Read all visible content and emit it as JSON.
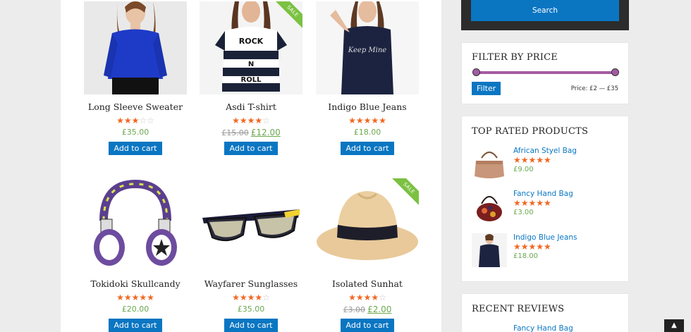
{
  "products": [
    {
      "name": "Long Sleeve Sweater",
      "rating": 3,
      "old_price": "",
      "price": "£35.00",
      "button": "Add to cart",
      "sale": false,
      "image": "blue-blouse-model"
    },
    {
      "name": "Asdi T-shirt",
      "rating": 4,
      "old_price": "£15.00",
      "price": "£12.00",
      "button": "Add to cart",
      "sale": true,
      "sale_label": "SALE",
      "image": "striped-tshirt-model"
    },
    {
      "name": "Indigo Blue Jeans",
      "rating": 5,
      "old_price": "",
      "price": "£18.00",
      "button": "Add to cart",
      "sale": false,
      "image": "navy-tee-model"
    },
    {
      "name": "Tokidoki Skullcandy",
      "rating": 5,
      "old_price": "",
      "price": "£20.00",
      "button": "Add to cart",
      "sale": false,
      "image": "headphones"
    },
    {
      "name": "Wayfarer Sunglasses",
      "rating": 4.5,
      "old_price": "",
      "price": "£35.00",
      "button": "Add to cart",
      "sale": false,
      "image": "sunglasses"
    },
    {
      "name": "Isolated Sunhat",
      "rating": 4.5,
      "old_price": "£3.00",
      "price": "£2.00",
      "button": "Add to cart",
      "sale": true,
      "sale_label": "SALE",
      "image": "straw-hat"
    }
  ],
  "search": {
    "button": "Search"
  },
  "filter_price": {
    "title": "FILTER BY PRICE",
    "button": "Filter",
    "range_text": "Price: £2 — £35",
    "min": 2,
    "max": 35
  },
  "top_rated": {
    "title": "TOP RATED PRODUCTS",
    "items": [
      {
        "name": "African Styel Bag",
        "rating": 5,
        "price": "£9.00",
        "image": "leather-bag"
      },
      {
        "name": "Fancy Hand Bag",
        "rating": 5,
        "price": "£3.00",
        "image": "patterned-bag"
      },
      {
        "name": "Indigo Blue Jeans",
        "rating": 5,
        "price": "£18.00",
        "image": "navy-tee-model"
      }
    ]
  },
  "recent_reviews": {
    "title": "RECENT REVIEWS",
    "items": [
      {
        "name": "Fancy Hand Bag"
      }
    ]
  },
  "colors": {
    "accent": "#0a76c2",
    "price": "#6aa84f",
    "star": "#f26722",
    "slider": "#a45aa3",
    "sale": "#7bc142"
  },
  "back_to_top_icon": "double-chevron-up-icon"
}
